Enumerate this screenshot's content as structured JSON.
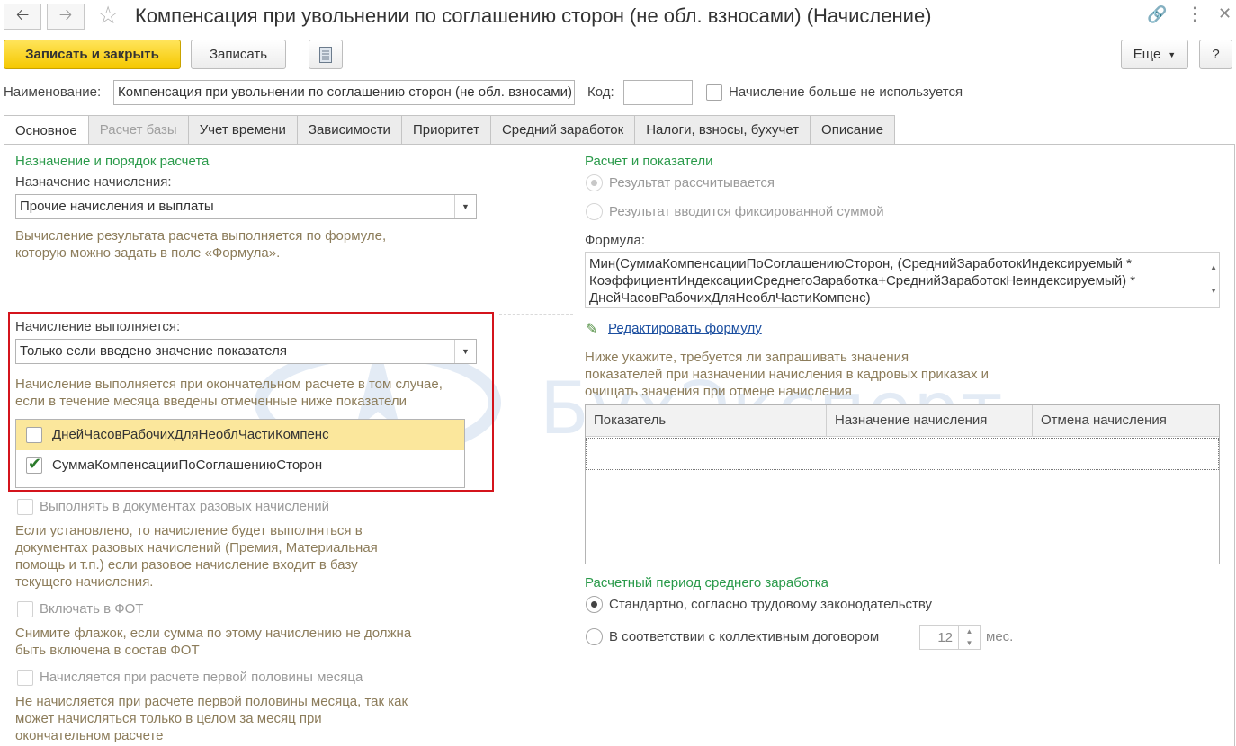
{
  "window": {
    "title": "Компенсация при увольнении по соглашению сторон (не обл. взносами) (Начисление)",
    "icons": [
      "arrow-left-icon",
      "arrow-right-icon",
      "star-icon",
      "link-icon",
      "more-icon",
      "close-icon"
    ]
  },
  "toolbar": {
    "save_close": "Записать и закрыть",
    "save": "Записать",
    "more": "Еще",
    "help": "?"
  },
  "header": {
    "name_label": "Наименование:",
    "name_value": "Компенсация при увольнении по соглашению сторон (не обл. взносами)",
    "code_label": "Код:",
    "code_value": "",
    "not_used_label": "Начисление больше не используется"
  },
  "tabs": [
    {
      "label": "Основное",
      "state": "active"
    },
    {
      "label": "Расчет базы",
      "state": "disabled"
    },
    {
      "label": "Учет времени",
      "state": "normal"
    },
    {
      "label": "Зависимости",
      "state": "normal"
    },
    {
      "label": "Приоритет",
      "state": "normal"
    },
    {
      "label": "Средний заработок",
      "state": "normal"
    },
    {
      "label": "Налоги, взносы, бухучет",
      "state": "normal"
    },
    {
      "label": "Описание",
      "state": "normal"
    }
  ],
  "left": {
    "section_title": "Назначение и порядок расчета",
    "purpose_label": "Назначение начисления:",
    "purpose_value": "Прочие начисления и выплаты",
    "purpose_hint_1": "Вычисление результата расчета выполняется по формуле,",
    "purpose_hint_2": "которую можно задать в поле «Формула».",
    "exec_label": "Начисление выполняется:",
    "exec_value": "Только если введено значение показателя",
    "exec_hint_1": "Начисление выполняется при окончательном расчете в том случае,",
    "exec_hint_2": "если в течение месяца введены отмеченные ниже показатели",
    "indicators": [
      {
        "name": "ДнейЧасовРабочихДляНеоблЧастиКомпенс",
        "checked": false
      },
      {
        "name": "СуммаКомпенсацииПоСоглашениюСторон",
        "checked": true
      }
    ],
    "one_time_label": "Выполнять в документах разовых начислений",
    "one_time_hint": [
      "Если установлено, то начисление будет выполняться в",
      "документах разовых начислений (Премия, Материальная",
      "помощь и т.п.) если разовое начисление входит в базу",
      "текущего начисления."
    ],
    "fot_label": "Включать в ФОТ",
    "fot_hint": [
      "Снимите флажок, если сумма по этому начислению не должна",
      "быть включена в состав ФОТ"
    ],
    "first_half_label": "Начисляется при расчете первой половины месяца",
    "first_half_hint": [
      "Не начисляется при расчете первой половины месяца, так как",
      "может начисляться только в целом за месяц при",
      "окончательном расчете"
    ]
  },
  "right": {
    "section_title": "Расчет и показатели",
    "radio_calc": "Результат рассчитывается",
    "radio_fixed": "Результат вводится фиксированной суммой",
    "formula_label": "Формула:",
    "formula_lines": [
      "Мин(СуммаКомпенсацииПоСоглашениюСторон, (СреднийЗаработокИндексируемый *",
      "КоэффициентИндексацииСреднегоЗаработка+СреднийЗаработокНеиндексируемый) *",
      "ДнейЧасовРабочихДляНеоблЧастиКомпенс)"
    ],
    "edit_formula": "Редактировать формулу",
    "request_hint": [
      "Ниже укажите, требуется ли запрашивать значения",
      "показателей при назначении начисления в кадровых приказах и",
      "очищать значения при отмене начисления"
    ],
    "table_headers": [
      "Показатель",
      "Назначение начисления",
      "Отмена начисления"
    ],
    "avg_section_title": "Расчетный период среднего заработка",
    "radio_standard": "Стандартно, согласно трудовому законодательству",
    "radio_collective": "В соответствии с коллективным договором",
    "months_value": "12",
    "months_unit": "мес."
  },
  "watermark": "БухЭксперт",
  "colors": {
    "accent_yellow": "#f5c800",
    "highlight_red": "#d4141c",
    "section_green": "#2a9a4a",
    "link_blue": "#1c4fa0"
  }
}
